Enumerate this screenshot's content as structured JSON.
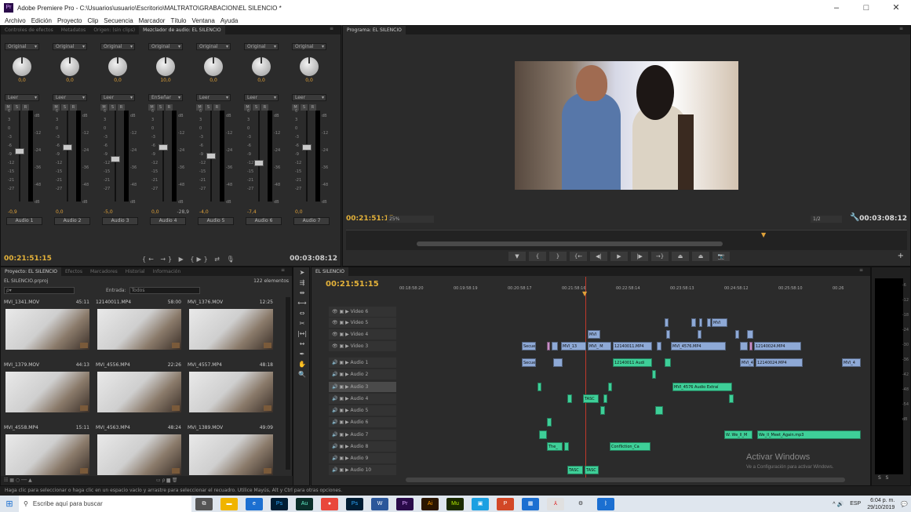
{
  "window": {
    "title": "Adobe Premiere Pro - C:\\Usuarios\\usuario\\Escritorio\\MALTRATO\\GRABACION\\EL SILENCIO *",
    "controls": [
      "–",
      "□",
      "✕"
    ]
  },
  "menu": [
    "Archivo",
    "Edición",
    "Proyecto",
    "Clip",
    "Secuencia",
    "Marcador",
    "Título",
    "Ventana",
    "Ayuda"
  ],
  "mixer": {
    "tabs": [
      "Controles de efectos",
      "Metadatos",
      "Origen: (sin clips)",
      "Mezclador de audio: EL SILENCIO"
    ],
    "channels": [
      {
        "mode": "Original",
        "pan": "0,0",
        "auto": "Leer",
        "volume": "-0,9",
        "peak": "",
        "name": "Audio 1",
        "fader": 0.56
      },
      {
        "mode": "Original",
        "pan": "0,0",
        "auto": "Leer",
        "volume": "0,0",
        "peak": "",
        "name": "Audio 2",
        "fader": 0.6
      },
      {
        "mode": "Original",
        "pan": "0,0",
        "auto": "Leer",
        "volume": "-5,0",
        "peak": "",
        "name": "Audio 3",
        "fader": 0.46
      },
      {
        "mode": "Original",
        "pan": "10,0",
        "auto": "EnSeñar",
        "volume": "0,0",
        "peak": "-28,9",
        "name": "Audio 4",
        "fader": 0.6
      },
      {
        "mode": "Original",
        "pan": "0,0",
        "auto": "Leer",
        "volume": "-4,0",
        "peak": "",
        "name": "Audio 5",
        "fader": 0.5
      },
      {
        "mode": "Original",
        "pan": "0,0",
        "auto": "Leer",
        "volume": "-7,4",
        "peak": "",
        "name": "Audio 6",
        "fader": 0.42
      },
      {
        "mode": "Original",
        "pan": "0,0",
        "auto": "Leer",
        "volume": "0,0",
        "peak": "",
        "name": "Audio 7",
        "fader": 0.6
      }
    ],
    "current_time": "00:21:51:15",
    "duration": "00:03:08:12"
  },
  "program": {
    "tab": "Programa: EL SILENCIO",
    "current_time": "00:21:51:15",
    "zoom": "25%",
    "resolution": "1/2",
    "duration": "00:03:08:12"
  },
  "project": {
    "tabs": [
      "Proyecto: EL SILENCIO",
      "Efectos",
      "Marcadores",
      "Historial",
      "Información"
    ],
    "file": "EL SILENCIO.prproj",
    "count": "122 elementos",
    "entrada_label": "Entrada:",
    "entrada_value": "Todos",
    "items": [
      {
        "name": "MVI_1341.MOV",
        "dur": "45:11"
      },
      {
        "name": "12140011.MP4",
        "dur": "58:00"
      },
      {
        "name": "MVI_1376.MOV",
        "dur": "12:25"
      },
      {
        "name": "MVI_1379.MOV",
        "dur": "44:13"
      },
      {
        "name": "MVI_4556.MP4",
        "dur": "22:26"
      },
      {
        "name": "MVI_4557.MP4",
        "dur": "48:18"
      },
      {
        "name": "MVI_4558.MP4",
        "dur": "15:11"
      },
      {
        "name": "MVI_4563.MP4",
        "dur": "48:24"
      },
      {
        "name": "MVI_1389.MOV",
        "dur": "49:09"
      }
    ]
  },
  "timeline": {
    "tab": "EL SILENCIO",
    "current_time": "00:21:51:15",
    "ruler": [
      "00:18:58:20",
      "00:19:58:19",
      "00:20:58:17",
      "00:21:58:16",
      "00:22:58:14",
      "00:23:58:13",
      "00:24:58:12",
      "00:25:58:10",
      "00:26"
    ],
    "tracks": [
      "Video 6",
      "Video 5",
      "Video 4",
      "Video 3",
      "Audio 1",
      "Audio 2",
      "Audio 3",
      "Audio 4",
      "Audio 5",
      "Audio 6",
      "Audio 7",
      "Audio 8",
      "Audio 9",
      "Audio 10"
    ],
    "clips": {
      "v3a": "Secue",
      "v3b": "MVI_13",
      "v3c": "MVI_ M",
      "v3d": "12140011.MP4",
      "v3e": "MVI_4576.MP4",
      "v3f": "12140024.MP4",
      "v4": "MVI",
      "v5": "MVI",
      "a1a": "Secue",
      "a1b": "12140011 Audi",
      "a1c": "MVI_4",
      "a1d": "12140024.MP4",
      "a1e": "MVI_4",
      "a3": "MVI_4576 Audio Extraí",
      "a4": "TASC",
      "a7": "W. We_ll_M",
      "a7b": "We_ll_Meet_Again.mp3",
      "a8a": "The_",
      "a8b": "Confliction_Ca",
      "a10a": "TASC",
      "a10b": "TASC"
    }
  },
  "watermark": {
    "line1": "Activar Windows",
    "line2": "Ve a Configuración para activar Windows."
  },
  "status_text": "Haga clic para seleccionar o haga clic en un espacio vacío y arrastre para seleccionar el recuadro. Utilice Mayús, Alt y Ctrl para otras opciones.",
  "taskbar": {
    "search_placeholder": "Escribe aquí para buscar",
    "lang": "ESP",
    "time": "6:04 p. m.",
    "date": "29/10/2019"
  }
}
